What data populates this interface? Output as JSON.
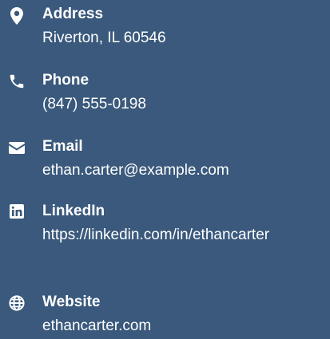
{
  "colors": {
    "background": "#3a597c",
    "text": "#ffffff"
  },
  "contact": {
    "items": [
      {
        "icon": "map-marker-icon",
        "label": "Address",
        "value": "Riverton, IL 60546"
      },
      {
        "icon": "phone-icon",
        "label": "Phone",
        "value": "(847) 555-0198"
      },
      {
        "icon": "envelope-icon",
        "label": "Email",
        "value": "ethan.carter@example.com"
      },
      {
        "icon": "linkedin-icon",
        "label": "LinkedIn",
        "value": "https://linkedin.com/in/ethancarter"
      },
      {
        "icon": "globe-icon",
        "label": "Website",
        "value": "ethancarter.com"
      }
    ]
  }
}
